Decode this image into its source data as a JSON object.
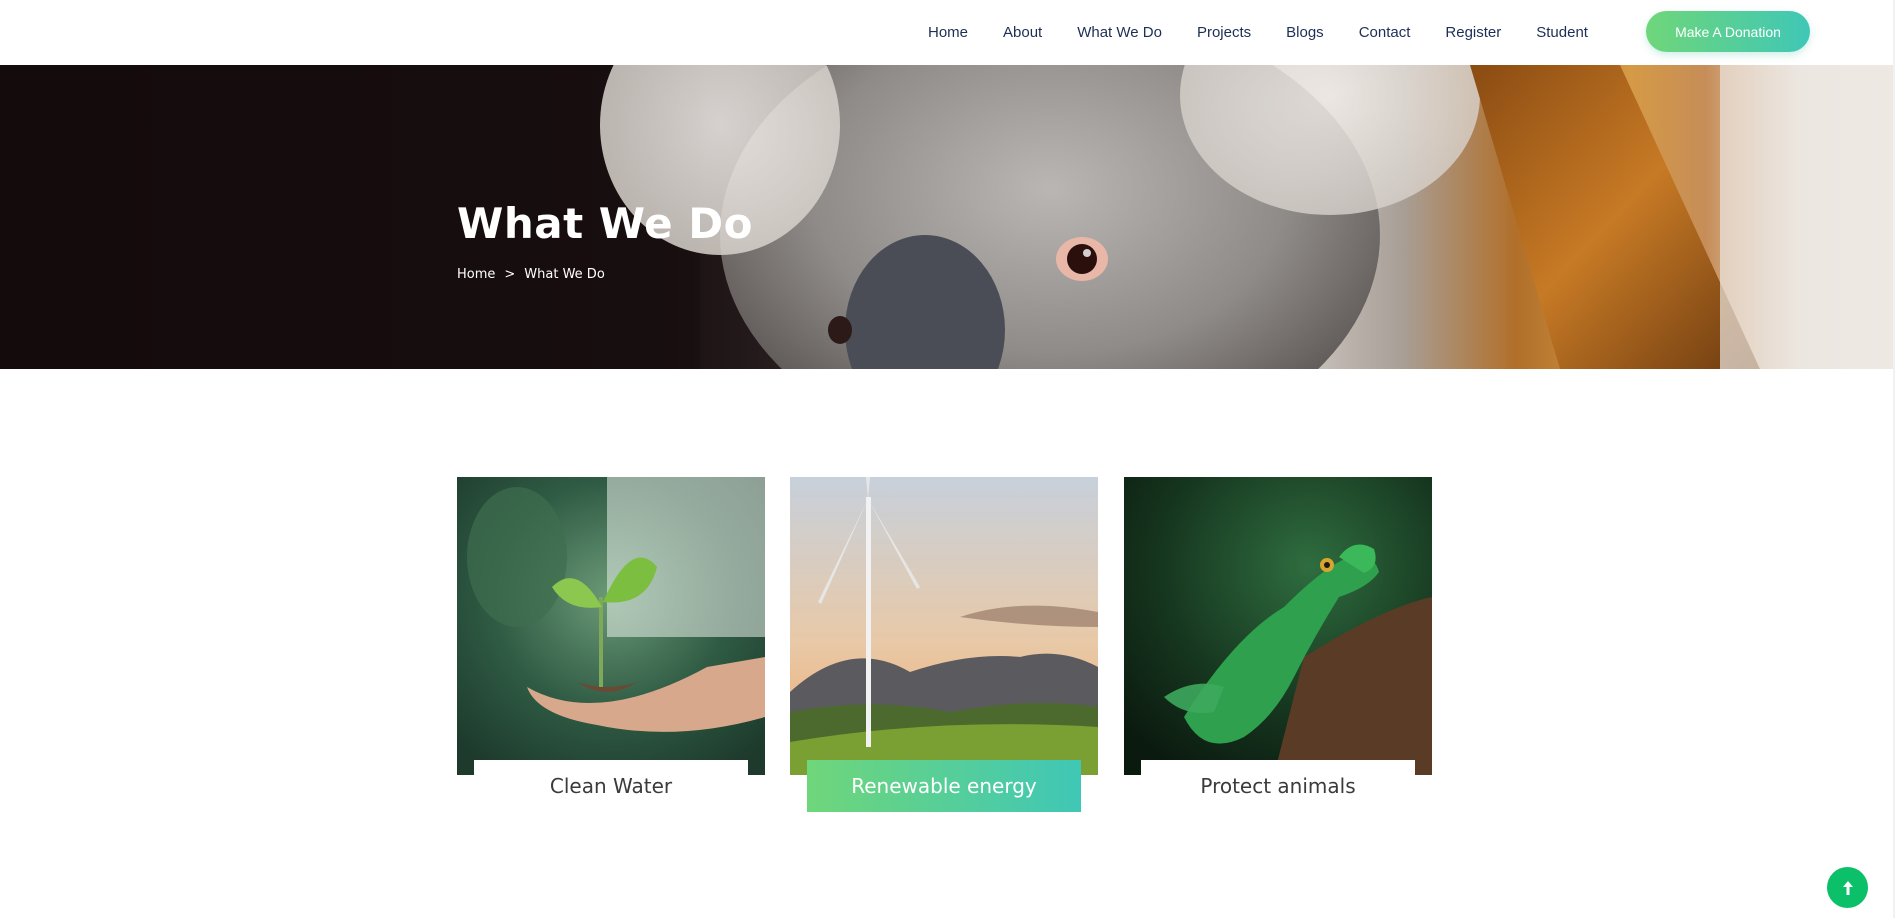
{
  "nav": {
    "items": [
      "Home",
      "About",
      "What We Do",
      "Projects",
      "Blogs",
      "Contact",
      "Register",
      "Student"
    ],
    "donate_label": "Make A Donation"
  },
  "hero": {
    "title": "What We Do",
    "breadcrumb": {
      "home": "Home",
      "separator": ">",
      "current": "What We Do"
    }
  },
  "cards": [
    {
      "label": "Clean Water",
      "photo": "seedling-in-hand",
      "active": false
    },
    {
      "label": "Renewable energy",
      "photo": "wind-turbine-landscape",
      "active": true
    },
    {
      "label": "Protect animals",
      "photo": "green-lizard",
      "active": false
    }
  ],
  "back_to_top": {
    "icon": "arrow-up-icon"
  },
  "colors": {
    "accent_start": "#6fd67a",
    "accent_end": "#3fc7b6",
    "back_to_top": "#0cc06a",
    "nav_text": "#1e2f56"
  }
}
